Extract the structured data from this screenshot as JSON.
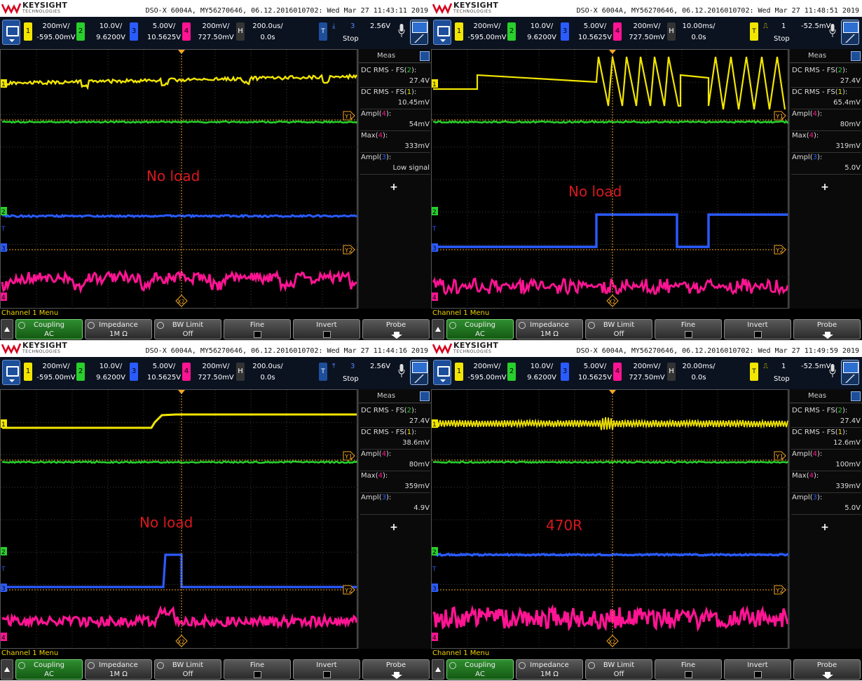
{
  "colors": {
    "ch1": "#f2e600",
    "ch2": "#27d02b",
    "ch3": "#2a5bff",
    "ch4": "#ff1493",
    "orange": "#f5a623",
    "trace_bg": "#000000"
  },
  "brand": {
    "name": "KEYSIGHT",
    "sub": "TECHNOLOGIES"
  },
  "channel_menu_label": "Channel 1 Menu",
  "softkeys": [
    {
      "label": "Coupling",
      "value": "AC"
    },
    {
      "label": "Impedance",
      "value": "1M Ω"
    },
    {
      "label": "BW Limit",
      "value": "Off"
    },
    {
      "label": "Fine",
      "value": ""
    },
    {
      "label": "Invert",
      "value": ""
    },
    {
      "label": "Probe",
      "value": ""
    }
  ],
  "meas_title": "Meas",
  "markers": {
    "y1": "Y1",
    "y2": "Y2",
    "x2": "X2",
    "ch1": "1",
    "ch2": "2",
    "ch3": "3",
    "ch4": "4",
    "t": "T"
  },
  "panels": [
    {
      "info": "DSO-X 6004A, MY56270646, 06.12.2016010702: Wed Mar 27 11:43:11 2019",
      "channels": [
        {
          "num": "1",
          "scale": "200mV/",
          "offset": "-595.00mV"
        },
        {
          "num": "2",
          "scale": "10.0V/",
          "offset": "9.6200V"
        },
        {
          "num": "3",
          "scale": "5.00V/",
          "offset": "10.5625V"
        },
        {
          "num": "4",
          "scale": "200mV/",
          "offset": "727.50mV"
        }
      ],
      "horizontal": {
        "label": "H",
        "scale": "200.0us/",
        "offset": "0.0s"
      },
      "trigger": {
        "label": "T",
        "icon": "falling-edge",
        "source": "3",
        "level": "2.56V",
        "mode": "Stop"
      },
      "annotation": "No load",
      "measurements": [
        {
          "name": "DC RMS - FS",
          "ch": "2",
          "value": "27.4V"
        },
        {
          "name": "DC RMS - FS",
          "ch": "1",
          "value": "10.45mV"
        },
        {
          "name": "Ampl",
          "ch": "4",
          "value": "54mV"
        },
        {
          "name": "Max",
          "ch": "4",
          "value": "333mV"
        },
        {
          "name": "Ampl",
          "ch": "3",
          "value": "Low signal"
        }
      ]
    },
    {
      "info": "DSO-X 6004A, MY56270646, 06.12.2016010702: Wed Mar 27 11:48:51 2019",
      "channels": [
        {
          "num": "1",
          "scale": "200mV/",
          "offset": "-595.00mV"
        },
        {
          "num": "2",
          "scale": "10.0V/",
          "offset": "9.6200V"
        },
        {
          "num": "3",
          "scale": "5.00V/",
          "offset": "10.5625V"
        },
        {
          "num": "4",
          "scale": "200mV/",
          "offset": "727.50mV"
        }
      ],
      "horizontal": {
        "label": "H",
        "scale": "10.00ms/",
        "offset": "0.0s"
      },
      "trigger": {
        "label": "T",
        "icon": "pulse",
        "source": "1",
        "level": "-52.5mV",
        "mode": "Stop"
      },
      "annotation": "No load",
      "measurements": [
        {
          "name": "DC RMS - FS",
          "ch": "2",
          "value": "27.4V"
        },
        {
          "name": "DC RMS - FS",
          "ch": "1",
          "value": "65.4mV"
        },
        {
          "name": "Ampl",
          "ch": "4",
          "value": "80mV"
        },
        {
          "name": "Max",
          "ch": "4",
          "value": "319mV"
        },
        {
          "name": "Ampl",
          "ch": "3",
          "value": "5.0V"
        }
      ]
    },
    {
      "info": "DSO-X 6004A, MY56270646, 06.12.2016010702: Wed Mar 27 11:44:16 2019",
      "channels": [
        {
          "num": "1",
          "scale": "200mV/",
          "offset": "-595.00mV"
        },
        {
          "num": "2",
          "scale": "10.0V/",
          "offset": "9.6200V"
        },
        {
          "num": "3",
          "scale": "5.00V/",
          "offset": "10.5625V"
        },
        {
          "num": "4",
          "scale": "200mV/",
          "offset": "727.50mV"
        }
      ],
      "horizontal": {
        "label": "H",
        "scale": "200.0us/",
        "offset": "0.0s"
      },
      "trigger": {
        "label": "T",
        "icon": "rising-edge",
        "source": "3",
        "level": "2.56V",
        "mode": "Stop"
      },
      "annotation": "No load",
      "measurements": [
        {
          "name": "DC RMS - FS",
          "ch": "2",
          "value": "27.4V"
        },
        {
          "name": "DC RMS - FS",
          "ch": "1",
          "value": "38.6mV"
        },
        {
          "name": "Ampl",
          "ch": "4",
          "value": "80mV"
        },
        {
          "name": "Max",
          "ch": "4",
          "value": "359mV"
        },
        {
          "name": "Ampl",
          "ch": "3",
          "value": "4.9V"
        }
      ]
    },
    {
      "info": "DSO-X 6004A, MY56270646, 06.12.2016010702: Wed Mar 27 11:49:59 2019",
      "channels": [
        {
          "num": "1",
          "scale": "200mV/",
          "offset": "-595.00mV"
        },
        {
          "num": "2",
          "scale": "10.0V/",
          "offset": "9.6200V"
        },
        {
          "num": "3",
          "scale": "5.00V/",
          "offset": "10.5625V"
        },
        {
          "num": "4",
          "scale": "200mV/",
          "offset": "727.50mV"
        }
      ],
      "horizontal": {
        "label": "H",
        "scale": "20.00ms/",
        "offset": "0.0s"
      },
      "trigger": {
        "label": "T",
        "icon": "pulse",
        "source": "1",
        "level": "-52.5mV",
        "mode": "Stop"
      },
      "annotation": "470R",
      "measurements": [
        {
          "name": "DC RMS - FS",
          "ch": "2",
          "value": "27.4V"
        },
        {
          "name": "DC RMS - FS",
          "ch": "1",
          "value": "12.6mV"
        },
        {
          "name": "Ampl",
          "ch": "4",
          "value": "100mV"
        },
        {
          "name": "Max",
          "ch": "4",
          "value": "339mV"
        },
        {
          "name": "Ampl",
          "ch": "3",
          "value": "5.0V"
        }
      ]
    }
  ]
}
